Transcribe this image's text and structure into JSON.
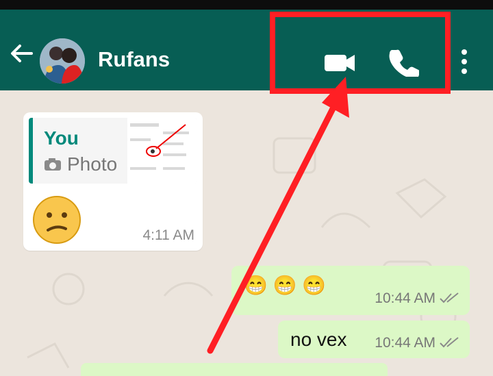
{
  "header": {
    "contact_name": "Rufans",
    "icons": [
      "back-arrow-icon",
      "video-call-icon",
      "voice-call-icon",
      "more-options-icon"
    ]
  },
  "messages": [
    {
      "side": "incoming",
      "reply_author": "You",
      "reply_label": "Photo",
      "time": "4:11 AM",
      "emoji_icon": "confused-face-icon"
    },
    {
      "side": "outgoing",
      "text": "😁 😁 😁",
      "time": "10:44 AM",
      "status_icon": "double-check-icon"
    },
    {
      "side": "outgoing",
      "text": "no vex",
      "time": "10:44 AM",
      "status_icon": "double-check-icon"
    }
  ],
  "colors": {
    "header": "#075e54",
    "chat_bg": "#ece5dd",
    "incoming_bubble": "#ffffff",
    "outgoing_bubble": "#dcf8c6",
    "annotation": "#ff1f24",
    "accent": "#00897b"
  }
}
